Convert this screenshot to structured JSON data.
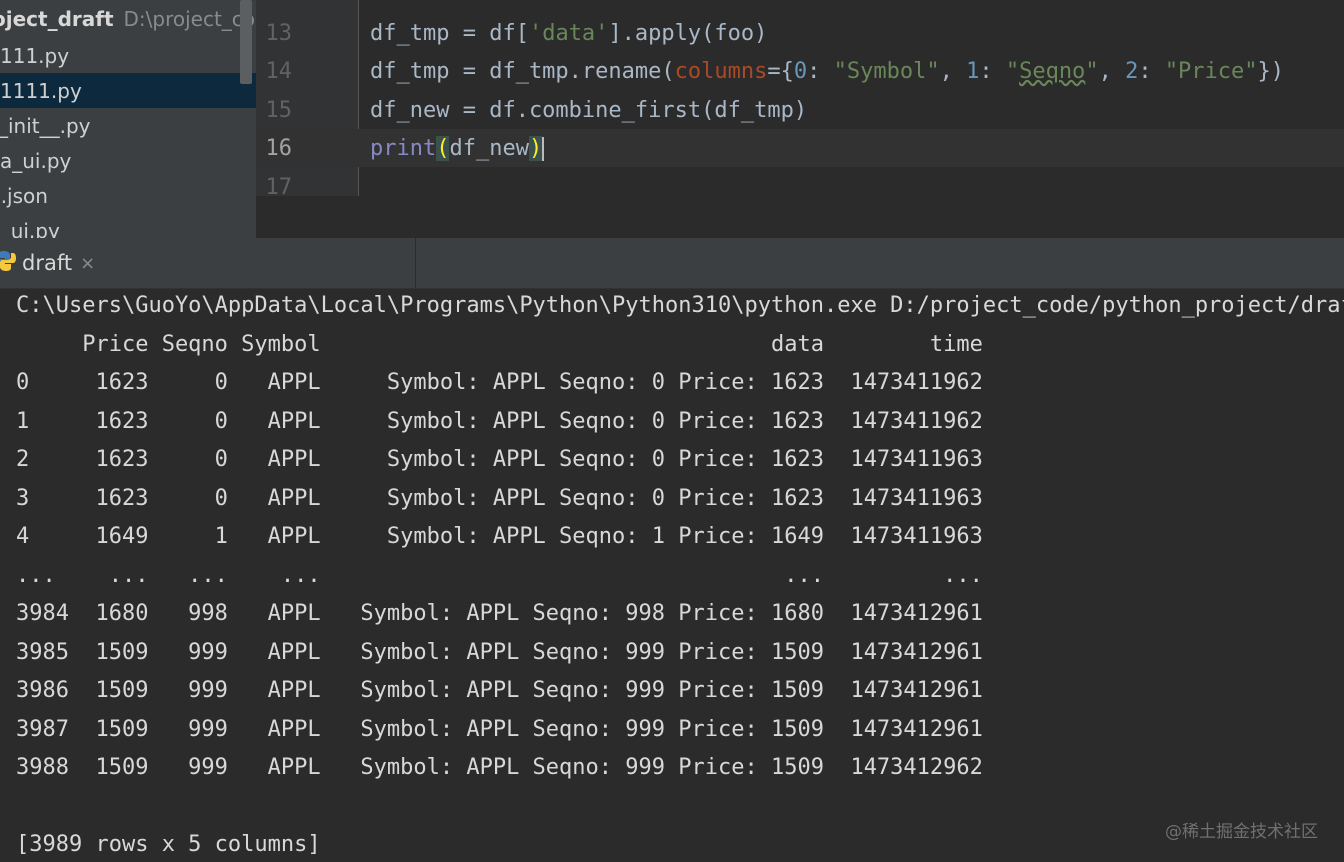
{
  "sidebar": {
    "project_name": "oject_draft",
    "project_path": "D:\\project_code",
    "files": [
      {
        "name": "111.py",
        "selected": false
      },
      {
        "name": "1111.py",
        "selected": true
      },
      {
        "name": "__init__.py",
        "selected": false
      },
      {
        "name": "a_ui.py",
        "selected": false
      },
      {
        "name": "b.json",
        "selected": false
      },
      {
        "name": "b_ui.py",
        "selected": false
      }
    ]
  },
  "editor": {
    "line_numbers": [
      "13",
      "14",
      "15",
      "16",
      "17"
    ],
    "current_line": "16"
  },
  "run": {
    "tab_label": "draft",
    "close_glyph": "×",
    "icon": "python-icon"
  },
  "console": {
    "command": "C:\\Users\\GuoYo\\AppData\\Local\\Programs\\Python\\Python310\\python.exe D:/project_code/python_project/draft.py",
    "lines": [
      "     Price Seqno Symbol                                  data        time",
      "0     1623     0   APPL     Symbol: APPL Seqno: 0 Price: 1623  1473411962",
      "1     1623     0   APPL     Symbol: APPL Seqno: 0 Price: 1623  1473411962",
      "2     1623     0   APPL     Symbol: APPL Seqno: 0 Price: 1623  1473411963",
      "3     1623     0   APPL     Symbol: APPL Seqno: 0 Price: 1623  1473411963",
      "4     1649     1   APPL     Symbol: APPL Seqno: 1 Price: 1649  1473411963",
      "...    ...   ...    ...                                   ...         ...",
      "3984  1680   998   APPL   Symbol: APPL Seqno: 998 Price: 1680  1473412961",
      "3985  1509   999   APPL   Symbol: APPL Seqno: 999 Price: 1509  1473412961",
      "3986  1509   999   APPL   Symbol: APPL Seqno: 999 Price: 1509  1473412961",
      "3987  1509   999   APPL   Symbol: APPL Seqno: 999 Price: 1509  1473412961",
      "3988  1509   999   APPL   Symbol: APPL Seqno: 999 Price: 1509  1473412962",
      "",
      "[3989 rows x 5 columns]"
    ],
    "watermark": "@稀土掘金技术社区"
  },
  "colors": {
    "background": "#2b2b2b",
    "sidebar_bg": "#3c3f41",
    "selected_file_bg": "#0d293e",
    "string": "#6a8759",
    "number": "#6897bb",
    "param": "#aa4926",
    "builtin": "#8888c6"
  }
}
